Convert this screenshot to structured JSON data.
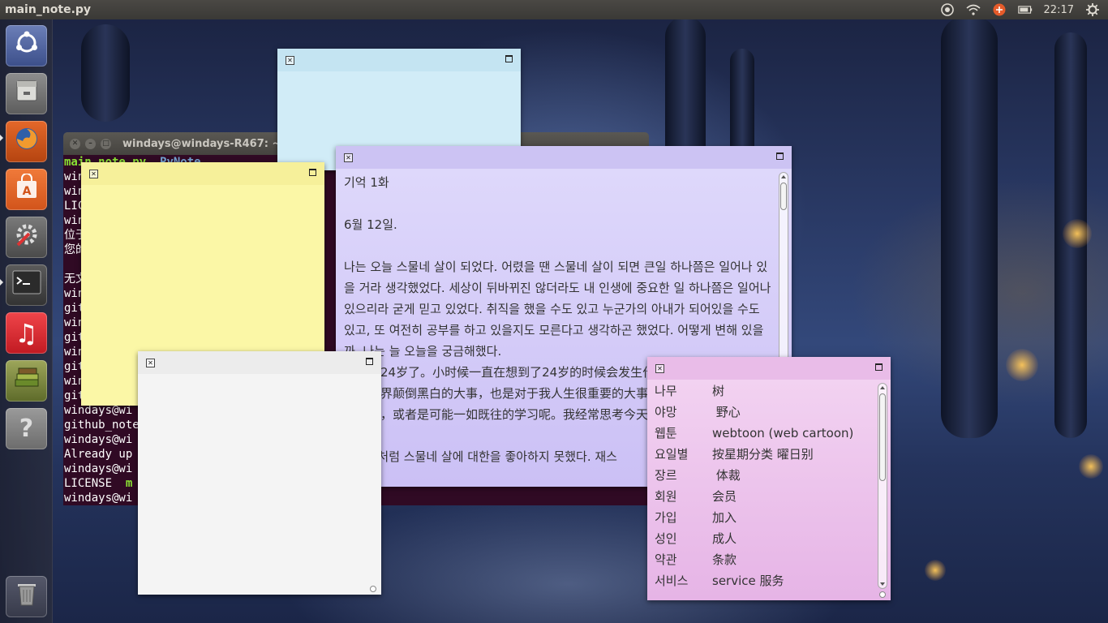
{
  "top_panel": {
    "app_title": "main_note.py",
    "clock": "22:17",
    "indicators": [
      "chrome-icon",
      "wifi-icon",
      "input-method-icon",
      "battery-icon",
      "settings-gear-icon"
    ]
  },
  "launcher": {
    "items": [
      {
        "name": "ubuntu-dash",
        "icon": "ubuntu-logo-icon"
      },
      {
        "name": "files",
        "icon": "file-cabinet-icon"
      },
      {
        "name": "firefox",
        "icon": "firefox-icon"
      },
      {
        "name": "software-center",
        "icon": "shopping-bag-icon"
      },
      {
        "name": "system-settings",
        "icon": "wrench-gear-icon"
      },
      {
        "name": "terminal",
        "icon": "terminal-icon"
      },
      {
        "name": "music",
        "icon": "music-note-icon"
      },
      {
        "name": "books",
        "icon": "books-icon"
      },
      {
        "name": "help",
        "icon": "question-mark-icon"
      },
      {
        "name": "trash",
        "icon": "trash-icon"
      }
    ]
  },
  "terminal": {
    "title": "windays@windays-R467: ~/",
    "lines": [
      {
        "a": "main_note.py",
        "b": "  PyNote"
      },
      {
        "a": "win",
        "b": ""
      },
      {
        "a": "win",
        "b": ""
      },
      {
        "a": "LIC",
        "b": ""
      },
      {
        "a": "win",
        "b": ""
      },
      {
        "a": "位于",
        "b": ""
      },
      {
        "a": "您的",
        "b": ""
      },
      {
        "a": "",
        "b": ""
      },
      {
        "a": "无文",
        "b": ""
      },
      {
        "a": "win",
        "b": ""
      },
      {
        "a": "git",
        "b": ""
      },
      {
        "a": "win",
        "b": ""
      },
      {
        "a": "git",
        "b": ""
      },
      {
        "a": "win",
        "b": ""
      },
      {
        "a": "git",
        "b": ""
      },
      {
        "a": "win",
        "b": ""
      },
      {
        "a": "git",
        "b": ""
      },
      {
        "a": "windays@wi",
        "b": ""
      },
      {
        "a": "github_note",
        "b": ""
      },
      {
        "a": "windays@wi",
        "b": ""
      },
      {
        "a": "Already up",
        "b": ""
      },
      {
        "a": "windays@wi",
        "b": ""
      },
      {
        "a": "LICENSE  ",
        "b": "m"
      },
      {
        "a": "windays@wi",
        "b": ""
      }
    ]
  },
  "notes": {
    "diary": {
      "paragraphs": [
        "기억 1화",
        "6월 12일.",
        "나는 오늘 스물네 살이 되었다. 어렸을 땐 스물네 살이 되면 큰일 하나쯤은 일어나 있을 거라 생각했었다. 세상이 뒤바뀌진 않더라도 내 인생에 중요한 일 하나쯤은 일어나 있으리라 굳게 믿고 있었다. 취직을 했을 수도 있고 누군가의 아내가 되어있을 수도 있고, 또 여전히 공부를 하고 있을지도 모른다고 생각하곤 했었다. 어떻게 변해 있을까. 나는 늘 오늘을 궁금해했다.",
        "今天满24岁了。小时候一直在想到了24岁的时候会发生什么大事，相信即使不是使世界颠倒黑白的大事，也是对于我人生很重要的大事。顺利就职，成为别人的老婆，或者是可能一如既往的学习呢。我经常思考今天。",
        "누구든처럼 스물네 살에 대한을 좋아하지 못했다. 재스"
      ]
    },
    "vocab": {
      "rows": [
        {
          "ko": "나무",
          "trans": "树"
        },
        {
          "ko": "야망",
          "trans": " 野心"
        },
        {
          "ko": "웹툰",
          "trans": "webtoon (web cartoon)"
        },
        {
          "ko": "요일별",
          "trans": "按星期分类 曜日别"
        },
        {
          "ko": "장르",
          "trans": " 体裁"
        },
        {
          "ko": "회원",
          "trans": "会员"
        },
        {
          "ko": "가입",
          "trans": "加入"
        },
        {
          "ko": "성인",
          "trans": "成人"
        },
        {
          "ko": "약관",
          "trans": "条款"
        },
        {
          "ko": "서비스",
          "trans": "service 服务"
        }
      ]
    }
  },
  "colors": {
    "note_blue": "#cdeaf7",
    "note_purple": "#d9d0fa",
    "note_yellow": "#fbf7a8",
    "note_white": "#f4f4f4",
    "note_pink": "#efc9ef",
    "terminal_bg": "#300a24",
    "panel_bg": "#3c3b37"
  }
}
